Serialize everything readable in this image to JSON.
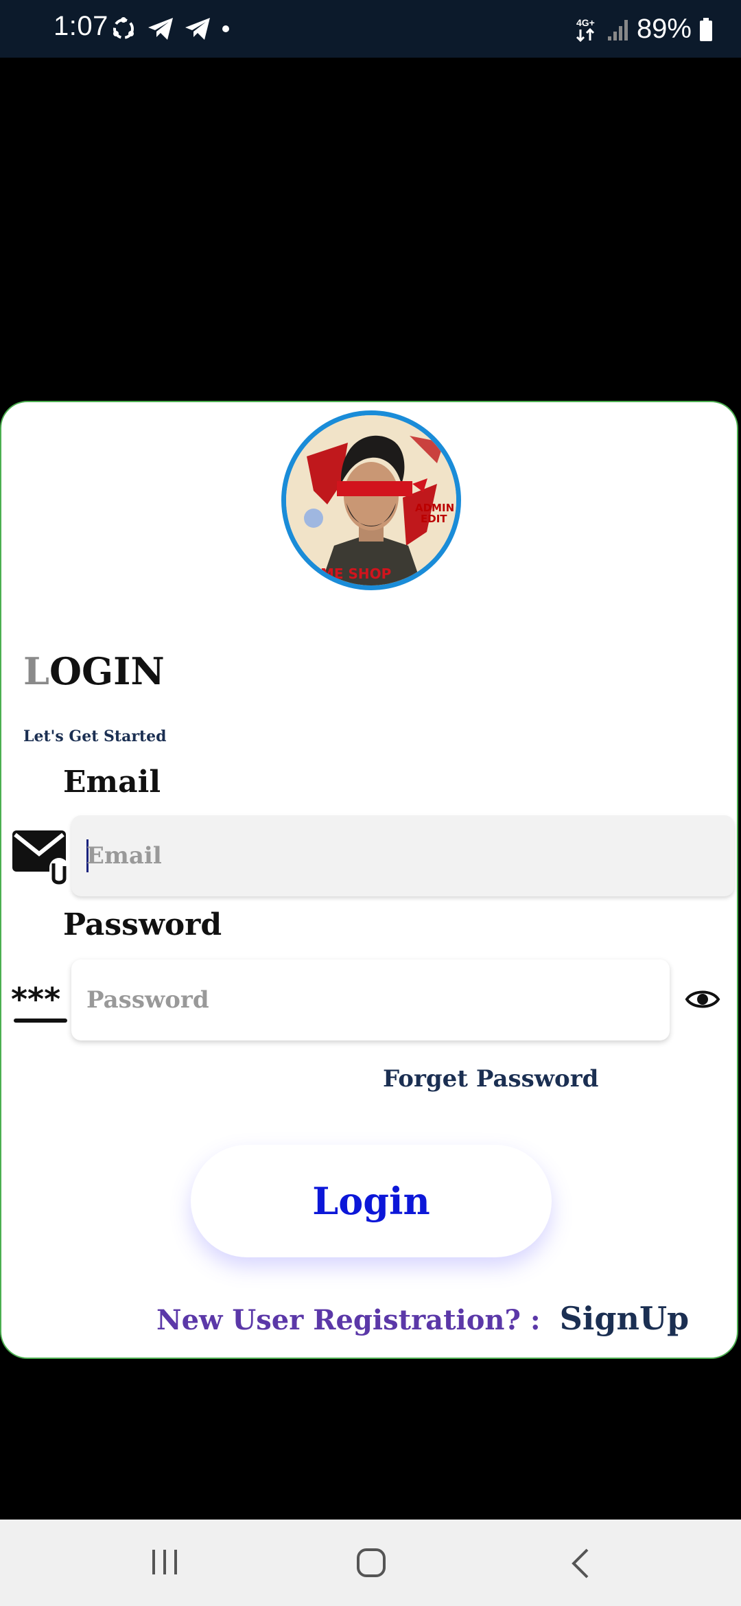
{
  "status_bar": {
    "time": "1:07",
    "network": "4G+",
    "battery": "89%"
  },
  "login": {
    "title_first": "L",
    "title_rest": "OGIN",
    "subtitle": "Let's Get Started",
    "email_label": "Email",
    "email_placeholder": "Email",
    "password_label": "Password",
    "password_placeholder": "Password",
    "password_mask_icon_text": "***",
    "forget_password": "Forget Password",
    "login_button": "Login",
    "registration_prompt": "New User Registration? :",
    "signup_link": "SignUp"
  },
  "colors": {
    "accent_blue": "#0c17d8",
    "navy": "#1b2f52",
    "purple": "#5b38a8",
    "card_border": "#4caf50"
  }
}
